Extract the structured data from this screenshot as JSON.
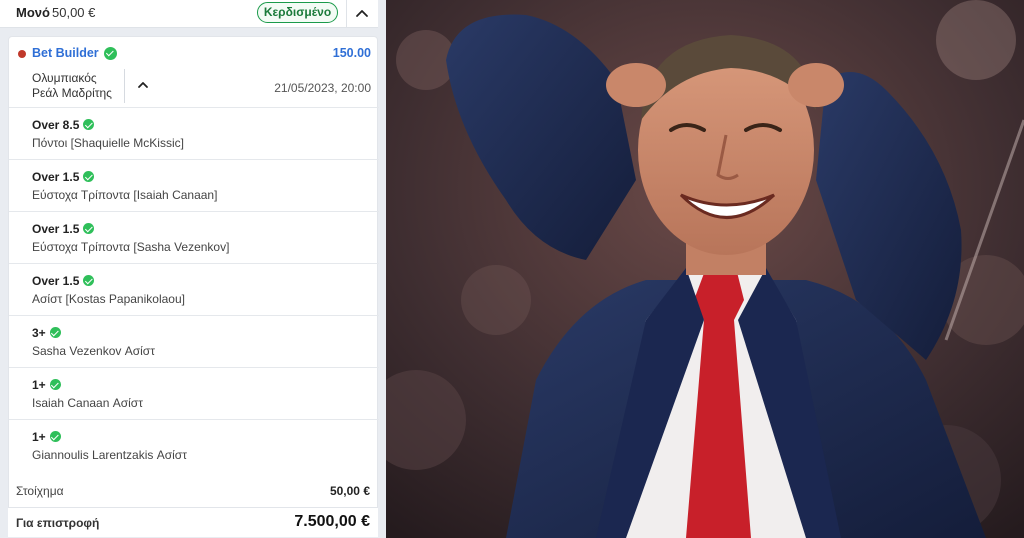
{
  "slip": {
    "type": "Μονό",
    "stake_header": "50,00 €",
    "status": "Κερδισμένο",
    "bet_builder": {
      "label": "Bet Builder",
      "odds": "150.00"
    },
    "match": {
      "home": "Ολυμπιακός",
      "away": "Ρεάλ Μαδρίτης",
      "datetime": "21/05/2023, 20:00"
    },
    "selections": [
      {
        "line": "Over 8.5",
        "market": "Πόντοι [Shaquielle McKissic]"
      },
      {
        "line": "Over 1.5",
        "market": "Εύστοχα Τρίποντα [Isaiah Canaan]"
      },
      {
        "line": "Over 1.5",
        "market": "Εύστοχα Τρίποντα [Sasha Vezenkov]"
      },
      {
        "line": "Over 1.5",
        "market": "Ασίστ [Kostas Papanikolaou]"
      },
      {
        "line": "3+",
        "market": "Sasha Vezenkov Ασίστ"
      },
      {
        "line": "1+",
        "market": "Isaiah Canaan Ασίστ"
      },
      {
        "line": "1+",
        "market": "Giannoulis Larentzakis Ασίστ"
      }
    ],
    "stake_label": "Στοίχημα",
    "stake_value": "50,00 €",
    "return_label": "Για επιστροφή",
    "return_value": "7.500,00 €"
  },
  "icons": {
    "collapse": "chevron-up-icon",
    "status_check": "check-circle-icon",
    "live_dot": "red-dot-icon"
  },
  "colors": {
    "accent_blue": "#2f6fd6",
    "success_green": "#2fbf5a",
    "won_badge_border": "#1a9a4a",
    "panel_bg": "#e9ecf1"
  }
}
